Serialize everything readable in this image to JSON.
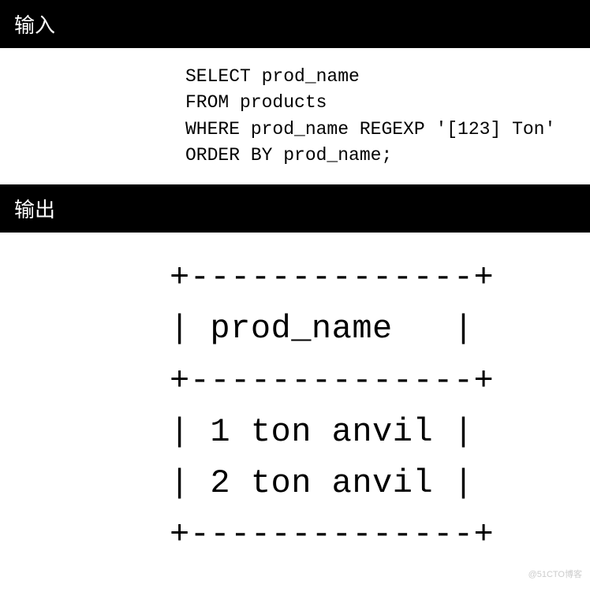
{
  "headers": {
    "input": "输入",
    "output": "输出"
  },
  "sql": {
    "line1": "SELECT prod_name",
    "line2": "FROM products",
    "line3": "WHERE prod_name REGEXP '[123] Ton'",
    "line4": "ORDER BY prod_name;"
  },
  "result": {
    "border_top": "+--------------+",
    "header_row": "| prod_name   |",
    "border_mid": "+--------------+",
    "row1": "| 1 ton anvil |",
    "row2": "| 2 ton anvil |",
    "border_bot": "+--------------+"
  },
  "watermark": "@51CTO博客"
}
